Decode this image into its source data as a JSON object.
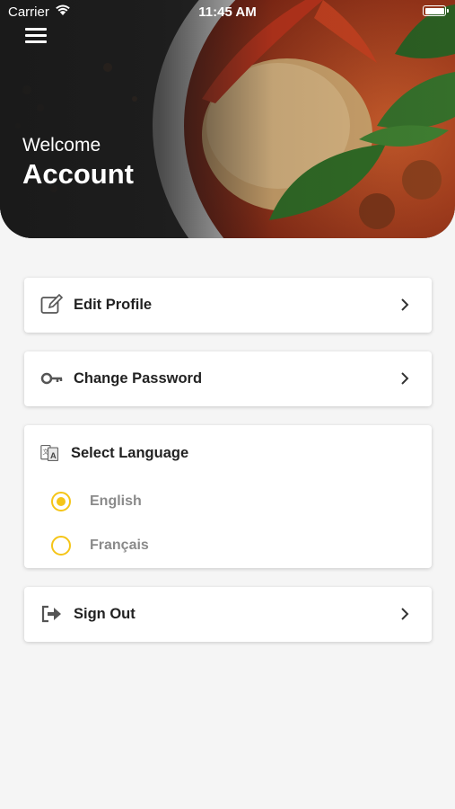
{
  "status_bar": {
    "carrier": "Carrier",
    "time": "11:45 AM"
  },
  "header": {
    "welcome": "Welcome",
    "title": "Account"
  },
  "menu": {
    "edit_profile": "Edit Profile",
    "change_password": "Change Password",
    "select_language": "Select Language",
    "sign_out": "Sign Out"
  },
  "language": {
    "options": [
      "English",
      "Français"
    ],
    "selected": "English"
  },
  "colors": {
    "accent": "#f5c518",
    "background": "#f5f5f5"
  }
}
